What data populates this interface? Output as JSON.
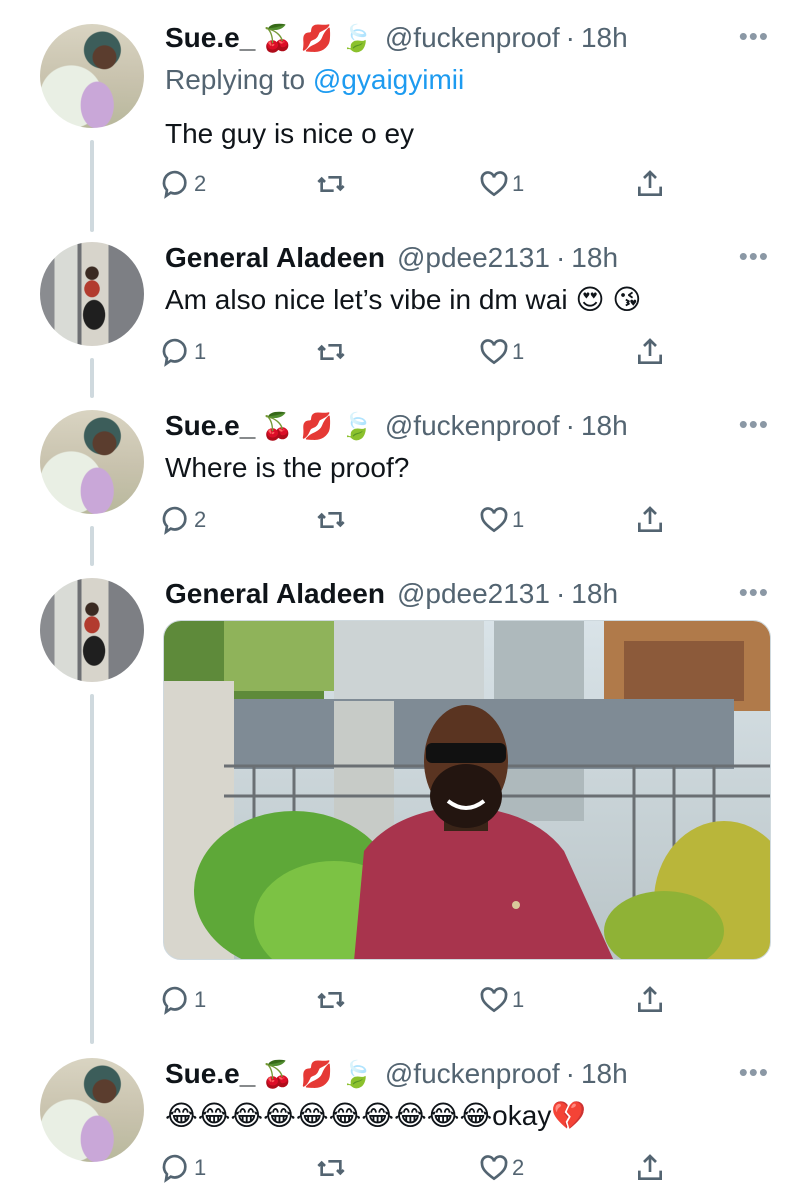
{
  "tweets": [
    {
      "author": "Sue.e_",
      "emoji": "🍒 💋 🍃",
      "handle": "@fuckenproof",
      "dot": "·",
      "time": "18h",
      "reply_prefix": "Replying to ",
      "reply_mention": "@gyaigyimii",
      "text": "The guy is nice o ey",
      "replies": "2",
      "retweets": "",
      "likes": "1"
    },
    {
      "author": "General Aladeen",
      "emoji": "",
      "handle": "@pdee2131",
      "dot": "·",
      "time": "18h",
      "text": "Am also nice let’s vibe in dm wai 😍 😘",
      "replies": "1",
      "retweets": "",
      "likes": "1"
    },
    {
      "author": "Sue.e_",
      "emoji": "🍒 💋 🍃",
      "handle": "@fuckenproof",
      "dot": "·",
      "time": "18h",
      "text": "Where is the proof?",
      "replies": "2",
      "retweets": "",
      "likes": "1"
    },
    {
      "author": "General Aladeen",
      "emoji": "",
      "handle": "@pdee2131",
      "dot": "·",
      "time": "18h",
      "text": "",
      "replies": "1",
      "retweets": "",
      "likes": "1"
    },
    {
      "author": "Sue.e_",
      "emoji": "🍒 💋 🍃",
      "handle": "@fuckenproof",
      "dot": "·",
      "time": "18h",
      "text": "😂😂😂😂😂😂😂😂😂😂okay💔",
      "replies": "1",
      "retweets": "",
      "likes": "2"
    }
  ],
  "icons": {
    "more": "more-icon",
    "reply": "reply-icon",
    "retweet": "retweet-icon",
    "like": "like-icon",
    "share": "share-icon"
  },
  "colors": {
    "link": "#1d9bf0",
    "secondary_text": "#536471",
    "thread_line": "#cfd9de"
  }
}
